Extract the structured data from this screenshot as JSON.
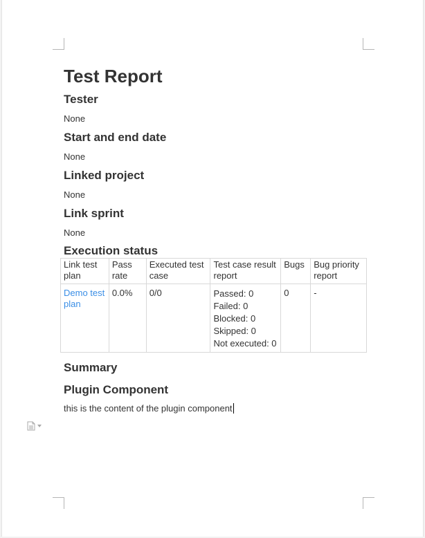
{
  "report": {
    "title": "Test Report",
    "sections": [
      {
        "heading": "Tester",
        "value": "None"
      },
      {
        "heading": "Start and end date",
        "value": "None"
      },
      {
        "heading": "Linked project",
        "value": "None"
      },
      {
        "heading": "Link sprint",
        "value": "None"
      }
    ],
    "execution": {
      "heading": "Execution status",
      "columns": [
        "Link test plan",
        "Pass rate",
        "Executed test case",
        "Test case result report",
        "Bugs",
        "Bug priority report"
      ],
      "rows": [
        {
          "plan": "Demo test plan",
          "pass_rate": "0.0%",
          "executed": "0/0",
          "results": [
            "Passed: 0",
            "Failed: 0",
            "Blocked: 0",
            "Skipped: 0",
            "Not executed: 0"
          ],
          "bugs": "0",
          "priority": "-"
        }
      ]
    },
    "summary_heading": "Summary",
    "plugin": {
      "heading": "Plugin Component",
      "content": "this is the content of the plugin component"
    }
  },
  "colors": {
    "link": "#3a8ee6",
    "text": "#333333",
    "border": "#d8d8d8"
  },
  "icons": {
    "block_handle": "document-icon",
    "block_menu": "caret-down-icon"
  }
}
